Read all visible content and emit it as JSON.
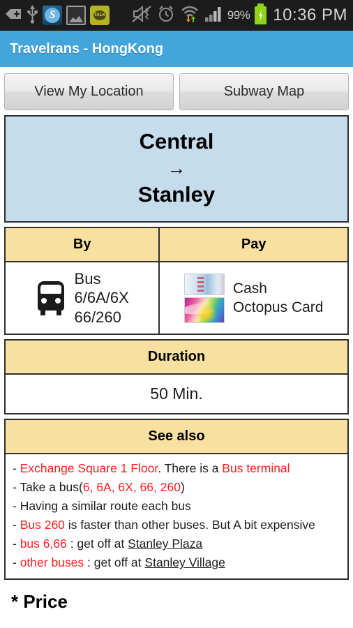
{
  "status_bar": {
    "icons": [
      {
        "name": "back-plus-icon",
        "glyph": "+"
      },
      {
        "name": "usb-icon",
        "glyph": "Ψ"
      },
      {
        "name": "skype-icon",
        "glyph": "S"
      },
      {
        "name": "gallery-icon",
        "glyph": ""
      },
      {
        "name": "kakaotalk-icon",
        "glyph": "TALK"
      },
      {
        "name": "mute-vibrate-icon",
        "glyph": ""
      },
      {
        "name": "alarm-icon",
        "glyph": ""
      },
      {
        "name": "wifi-data-icon",
        "glyph": ""
      },
      {
        "name": "signal-bars-icon",
        "glyph": ""
      }
    ],
    "battery_percent": "99%",
    "battery_charging": true,
    "clock": "10:36 PM"
  },
  "title_bar": {
    "title": "Travelrans - HongKong",
    "background": "#42a5dc"
  },
  "buttons": [
    {
      "name": "view-my-location-button",
      "label": "View My Location"
    },
    {
      "name": "subway-map-button",
      "label": "Subway Map"
    }
  ],
  "route_card": {
    "origin": "Central",
    "arrow": "→",
    "destination": "Stanley",
    "background": "#c5dcec"
  },
  "transport_table": {
    "header_background": "#f7e0a0",
    "by": {
      "header": "By",
      "icon": "bus-icon",
      "lines": [
        "Bus",
        "6/6A/6X",
        "66/260"
      ]
    },
    "pay": {
      "header": "Pay",
      "icons": [
        "cash-note-icon",
        "octopus-card-icon"
      ],
      "lines": [
        "Cash",
        "Octopus Card"
      ]
    }
  },
  "duration": {
    "header": "Duration",
    "value": "50 Min."
  },
  "see_also": {
    "header": "See also",
    "lines": [
      {
        "parts": [
          {
            "text": "- ",
            "style": "plain"
          },
          {
            "text": "Exchange Square 1 Floor",
            "style": "red"
          },
          {
            "text": ". There is a ",
            "style": "plain"
          },
          {
            "text": "Bus terminal",
            "style": "red"
          }
        ]
      },
      {
        "parts": [
          {
            "text": "- Take a bus(",
            "style": "plain"
          },
          {
            "text": "6, 6A, 6X, 66, 260",
            "style": "red"
          },
          {
            "text": ")",
            "style": "plain"
          }
        ]
      },
      {
        "parts": [
          {
            "text": "- Having a similar route each bus",
            "style": "plain"
          }
        ]
      },
      {
        "parts": [
          {
            "text": "- ",
            "style": "plain"
          },
          {
            "text": "Bus 260",
            "style": "red"
          },
          {
            "text": " is faster than other buses. But A bit expensive",
            "style": "plain"
          }
        ]
      },
      {
        "parts": [
          {
            "text": "- ",
            "style": "plain"
          },
          {
            "text": "bus 6,66",
            "style": "red"
          },
          {
            "text": " : get off at ",
            "style": "plain"
          },
          {
            "text": "Stanley Plaza",
            "style": "underline"
          }
        ]
      },
      {
        "parts": [
          {
            "text": "- ",
            "style": "plain"
          },
          {
            "text": "other buses",
            "style": "red"
          },
          {
            "text": " : get off at ",
            "style": "plain"
          },
          {
            "text": "Stanley Village",
            "style": "underline"
          }
        ]
      }
    ]
  },
  "price_section": {
    "title": "* Price"
  },
  "colors": {
    "accent_blue": "#42a5dc",
    "route_card_blue": "#c5dcec",
    "table_header_yellow": "#f7e0a0",
    "highlight_red": "#ff2020",
    "border_dark": "#2f2f2f"
  }
}
